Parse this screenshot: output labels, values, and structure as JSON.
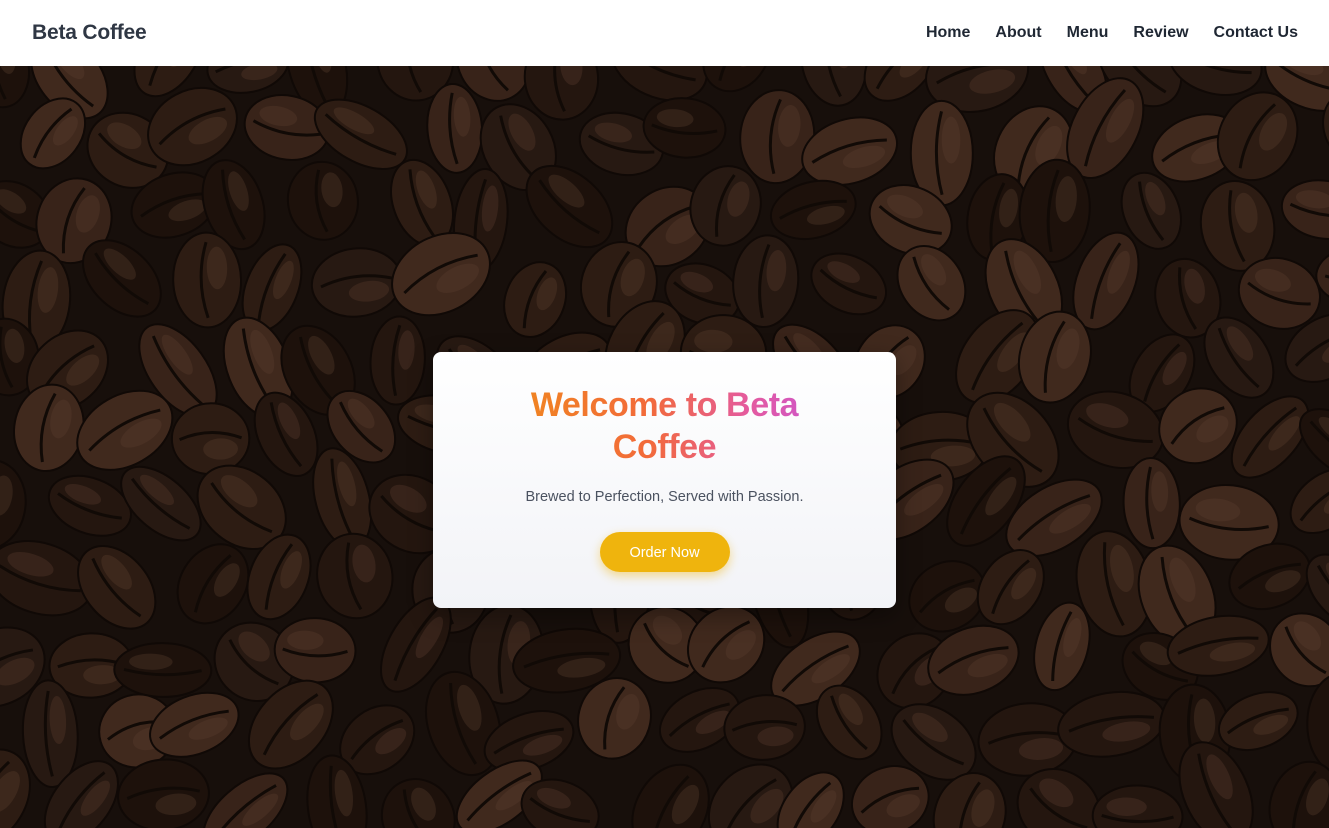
{
  "header": {
    "brand": "Beta Coffee",
    "nav": [
      {
        "label": "Home"
      },
      {
        "label": "About"
      },
      {
        "label": "Menu"
      },
      {
        "label": "Review"
      },
      {
        "label": "Contact Us"
      }
    ]
  },
  "hero": {
    "title": "Welcome to Beta Coffee",
    "subtitle": "Brewed to Perfection, Served with Passion.",
    "cta_label": "Order Now"
  },
  "colors": {
    "brand_text": "#2f3744",
    "cta_background": "#efb40d",
    "title_gradient_start": "#f08a1c",
    "title_gradient_end": "#c754d6"
  }
}
